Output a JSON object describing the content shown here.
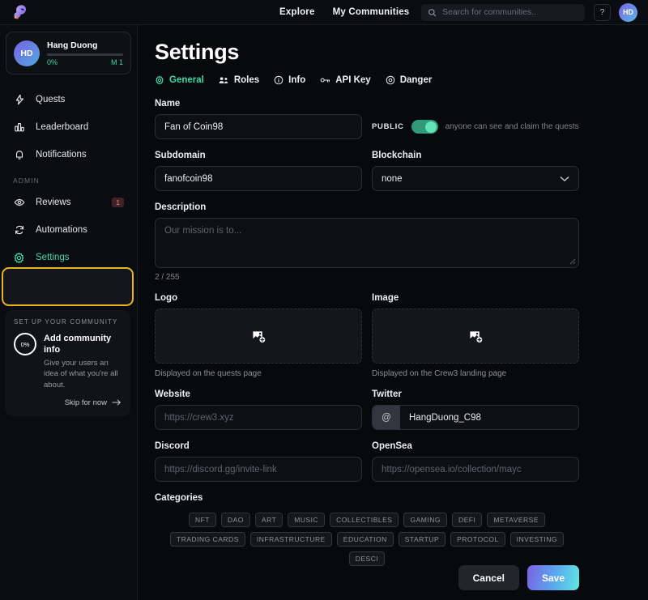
{
  "topbar": {
    "logo_icon": "crew3-blob-logo",
    "nav": [
      {
        "label": "Explore",
        "name": "explore"
      },
      {
        "label": "My Communities",
        "name": "my-communities"
      }
    ],
    "search_placeholder": "Search for communities..",
    "search_icon": "search-icon",
    "help_label": "?",
    "avatar_initials": "HD"
  },
  "sidebar": {
    "profile": {
      "avatar_initials": "HD",
      "name": "Hang Duong",
      "progress_percent": "0%",
      "level": "M 1",
      "progress_value": 0
    },
    "items": [
      {
        "label": "Quests",
        "icon": "lightning-icon",
        "name": "quests"
      },
      {
        "label": "Leaderboard",
        "icon": "bar-chart-icon",
        "name": "leaderboard"
      },
      {
        "label": "Notifications",
        "icon": "bell-icon",
        "name": "notifications"
      }
    ],
    "admin_section_label": "ADMIN",
    "admin_items": [
      {
        "label": "Reviews",
        "icon": "eye-icon",
        "name": "reviews",
        "badge": "1"
      },
      {
        "label": "Automations",
        "icon": "refresh-icon",
        "name": "automations",
        "badge": ""
      },
      {
        "label": "Settings",
        "icon": "gear-icon",
        "name": "settings",
        "badge": ""
      }
    ],
    "setup_card": {
      "header": "SET UP YOUR COMMUNITY",
      "progress": "0%",
      "title": "Add community info",
      "subtitle": "Give your users an idea of what you're all about.",
      "skip_label": "Skip for now",
      "skip_icon": "arrow-right-icon"
    }
  },
  "main": {
    "title": "Settings",
    "tabs": [
      {
        "label": "General",
        "icon": "gear-icon",
        "active": true
      },
      {
        "label": "Roles",
        "icon": "users-icon",
        "active": false
      },
      {
        "label": "Info",
        "icon": "info-circle-icon",
        "active": false
      },
      {
        "label": "API Key",
        "icon": "key-icon",
        "active": false
      },
      {
        "label": "Danger",
        "icon": "target-icon",
        "active": false
      }
    ],
    "name": {
      "label": "Name",
      "value": "Fan of Coin98"
    },
    "public": {
      "label": "PUBLIC",
      "enabled": true,
      "hint": "anyone can see and claim the quests"
    },
    "subdomain": {
      "label": "Subdomain",
      "value": "fanofcoin98"
    },
    "blockchain": {
      "label": "Blockchain",
      "value": "none",
      "chevron_icon": "chevron-down-icon"
    },
    "description": {
      "label": "Description",
      "placeholder": "Our mission is to...",
      "counter": "2 / 255"
    },
    "logo": {
      "label": "Logo",
      "icon": "image-add-icon",
      "caption": "Displayed on the quests page"
    },
    "image": {
      "label": "Image",
      "icon": "image-add-icon",
      "caption": "Displayed on the Crew3 landing page"
    },
    "website": {
      "label": "Website",
      "placeholder": "https://crew3.xyz",
      "value": ""
    },
    "twitter": {
      "label": "Twitter",
      "prefix": "@",
      "value": "HangDuong_C98"
    },
    "discord": {
      "label": "Discord",
      "placeholder": "https://discord.gg/invite-link",
      "value": ""
    },
    "opensea": {
      "label": "OpenSea",
      "placeholder": "https://opensea.io/collection/mayc",
      "value": ""
    },
    "categories": {
      "label": "Categories",
      "chips": [
        "NFT",
        "DAO",
        "ART",
        "MUSIC",
        "COLLECTIBLES",
        "GAMING",
        "DEFI",
        "METAVERSE",
        "TRADING CARDS",
        "INFRASTRUCTURE",
        "EDUCATION",
        "STARTUP",
        "PROTOCOL",
        "INVESTING",
        "DESCI"
      ]
    },
    "cancel_label": "Cancel",
    "save_label": "Save"
  },
  "colors": {
    "accent_green": "#3fd9a4",
    "focus_ring": "#e8b422",
    "save_gradient_start": "#7b61e4",
    "save_gradient_end": "#5ee8e0",
    "badge_red": "#e08a8a"
  }
}
